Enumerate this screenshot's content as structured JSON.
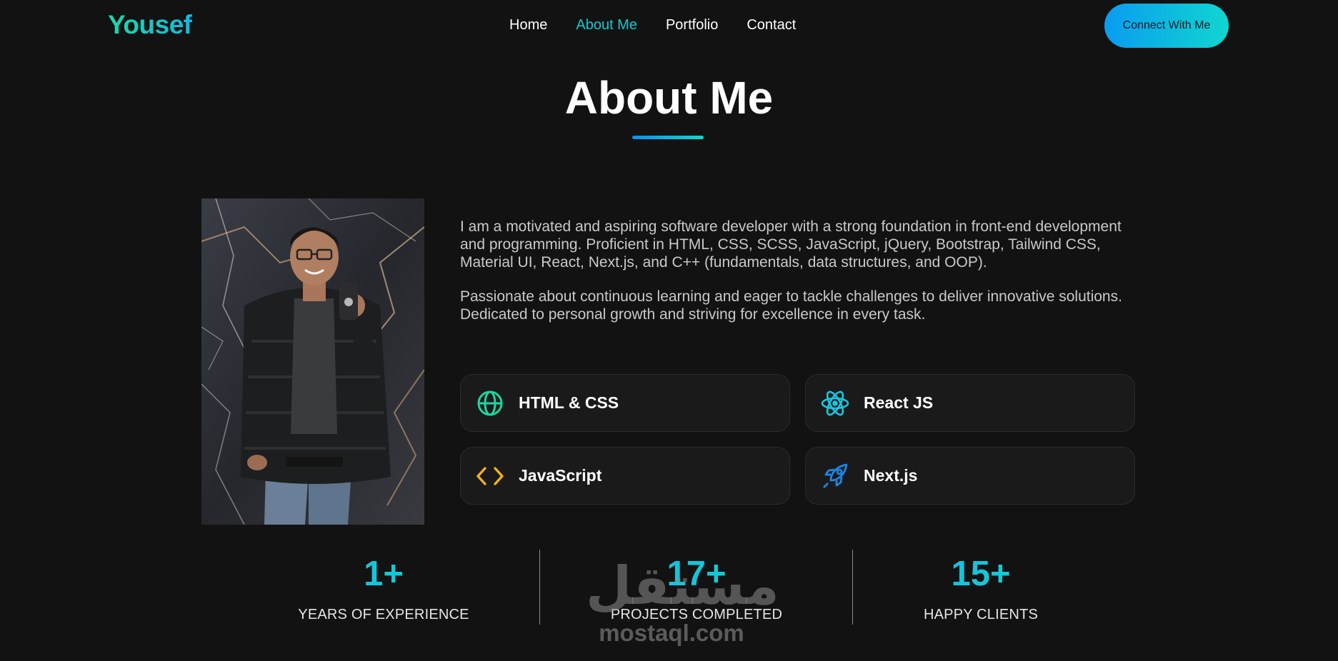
{
  "nav": {
    "logo": "Yousef",
    "links": [
      {
        "label": "Home",
        "active": false
      },
      {
        "label": "About Me",
        "active": true
      },
      {
        "label": "Portfolio",
        "active": false
      },
      {
        "label": "Contact",
        "active": false
      }
    ],
    "cta_label": "Connect With Me"
  },
  "about": {
    "title": "About Me",
    "bio": [
      "I am a motivated and aspiring software developer with a strong foundation in front-end development and programming. Proficient in HTML, CSS, SCSS, JavaScript, jQuery, Bootstrap, Tailwind CSS, Material UI, React, Next.js, and C++ (fundamentals, data structures, and OOP).",
      "Passionate about continuous learning and eager to tackle challenges to deliver innovative solutions. Dedicated to personal growth and striving for excellence in every task."
    ],
    "photo_icon": "profile-photo"
  },
  "skills": [
    {
      "label": "HTML & CSS",
      "icon": "globe-icon",
      "color": "#1fd5a0"
    },
    {
      "label": "React JS",
      "icon": "atom-icon",
      "color": "#16c9e6"
    },
    {
      "label": "JavaScript",
      "icon": "code-icon",
      "color": "#f0b21b"
    },
    {
      "label": "Next.js",
      "icon": "rocket-icon",
      "color": "#1a86e8"
    }
  ],
  "stats": [
    {
      "value": "1+",
      "label": "YEARS OF EXPERIENCE"
    },
    {
      "value": "17+",
      "label": "PROJECTS COMPLETED"
    },
    {
      "value": "15+",
      "label": "HAPPY CLIENTS"
    }
  ],
  "watermark": {
    "arabic": "مستقل",
    "latin": "mostaql.com"
  },
  "colors": {
    "background": "#131212",
    "accent": "#13c8cf",
    "accent_blue": "#0a9cf0",
    "card": "#1b1a1a"
  }
}
